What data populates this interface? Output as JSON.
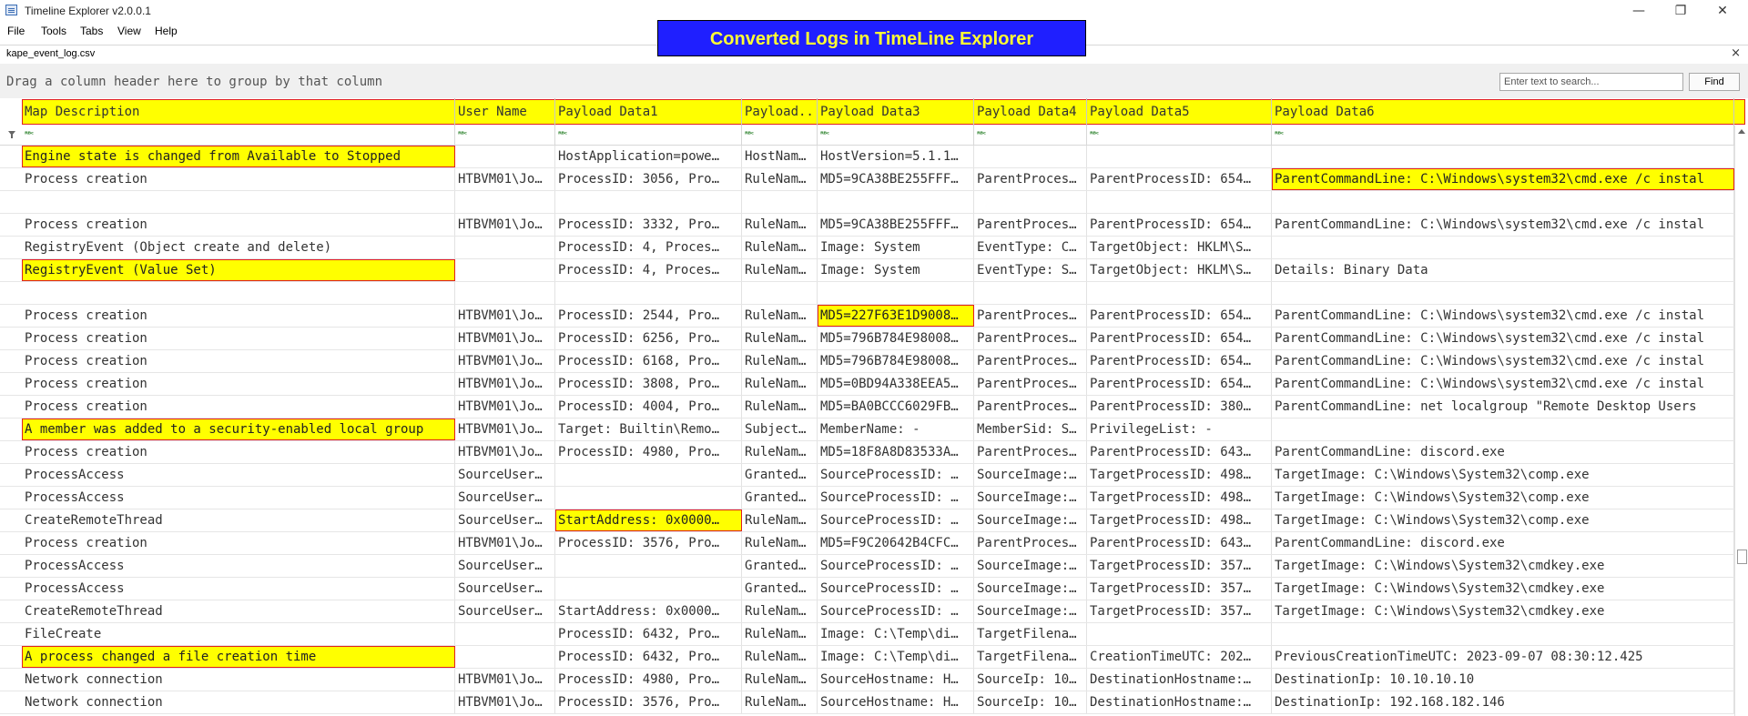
{
  "window": {
    "title": "Timeline Explorer v2.0.0.1",
    "minimize": "—",
    "maximize": "❐",
    "close": "✕"
  },
  "menu": [
    "File",
    "Tools",
    "Tabs",
    "View",
    "Help"
  ],
  "banner": "Converted Logs in TimeLine Explorer",
  "tab": {
    "label": "kape_event_log.csv",
    "close": "×"
  },
  "group_hint": "Drag a column header here to group by that column",
  "search": {
    "placeholder": "Enter text to search...",
    "find_label": "Find"
  },
  "columns": [
    "Map Description",
    "User Name",
    "Payload Data1",
    "Payload...",
    "Payload Data3",
    "Payload Data4",
    "Payload Data5",
    "Payload Data6"
  ],
  "filter_glyph": "ᴿᴮᶜ",
  "rows": [
    [
      "Engine state is changed from Available to Stopped",
      "",
      "HostApplication=powe…",
      "HostNam…",
      "HostVersion=5.1.1…",
      "",
      "",
      ""
    ],
    [
      "Process creation",
      "HTBVM01\\Jo…",
      "ProcessID: 3056, Pro…",
      "RuleNam…",
      "MD5=9CA38BE255FFF…",
      "ParentProces…",
      "ParentProcessID: 654…",
      "ParentCommandLine: C:\\Windows\\system32\\cmd.exe /c instal"
    ],
    [
      "",
      "",
      "",
      "",
      "",
      "",
      "",
      ""
    ],
    [
      "Process creation",
      "HTBVM01\\Jo…",
      "ProcessID: 3332, Pro…",
      "RuleNam…",
      "MD5=9CA38BE255FFF…",
      "ParentProces…",
      "ParentProcessID: 654…",
      "ParentCommandLine: C:\\Windows\\system32\\cmd.exe /c instal"
    ],
    [
      "RegistryEvent (Object create and delete)",
      "",
      "ProcessID: 4, Proces…",
      "RuleNam…",
      "Image: System",
      "EventType: C…",
      "TargetObject: HKLM\\S…",
      ""
    ],
    [
      "RegistryEvent (Value Set)",
      "",
      "ProcessID: 4, Proces…",
      "RuleNam…",
      "Image: System",
      "EventType: S…",
      "TargetObject: HKLM\\S…",
      "Details: Binary Data"
    ],
    [
      "",
      "",
      "",
      "",
      "",
      "",
      "",
      ""
    ],
    [
      "Process creation",
      "HTBVM01\\Jo…",
      "ProcessID: 2544, Pro…",
      "RuleNam…",
      "MD5=227F63E1D9008…",
      "ParentProces…",
      "ParentProcessID: 654…",
      "ParentCommandLine: C:\\Windows\\system32\\cmd.exe /c instal"
    ],
    [
      "Process creation",
      "HTBVM01\\Jo…",
      "ProcessID: 6256, Pro…",
      "RuleNam…",
      "MD5=796B784E98008…",
      "ParentProces…",
      "ParentProcessID: 654…",
      "ParentCommandLine: C:\\Windows\\system32\\cmd.exe /c instal"
    ],
    [
      "Process creation",
      "HTBVM01\\Jo…",
      "ProcessID: 6168, Pro…",
      "RuleNam…",
      "MD5=796B784E98008…",
      "ParentProces…",
      "ParentProcessID: 654…",
      "ParentCommandLine: C:\\Windows\\system32\\cmd.exe /c instal"
    ],
    [
      "Process creation",
      "HTBVM01\\Jo…",
      "ProcessID: 3808, Pro…",
      "RuleNam…",
      "MD5=0BD94A338EEA5…",
      "ParentProces…",
      "ParentProcessID: 654…",
      "ParentCommandLine: C:\\Windows\\system32\\cmd.exe /c instal"
    ],
    [
      "Process creation",
      "HTBVM01\\Jo…",
      "ProcessID: 4004, Pro…",
      "RuleNam…",
      "MD5=BA0BCCC6029FB…",
      "ParentProces…",
      "ParentProcessID: 380…",
      "ParentCommandLine: net  localgroup \"Remote Desktop Users"
    ],
    [
      "A member was added to a security-enabled local group",
      "HTBVM01\\Jo…",
      "Target: Builtin\\Remo…",
      "Subject…",
      "MemberName: -",
      "MemberSid: S…",
      "PrivilegeList: -",
      ""
    ],
    [
      "Process creation",
      "HTBVM01\\Jo…",
      "ProcessID: 4980, Pro…",
      "RuleNam…",
      "MD5=18F8A8D83533A…",
      "ParentProces…",
      "ParentProcessID: 643…",
      "ParentCommandLine: discord.exe"
    ],
    [
      "ProcessAccess",
      "SourceUser…",
      "",
      "Granted…",
      "SourceProcessID: …",
      "SourceImage:…",
      "TargetProcessID: 498…",
      "TargetImage: C:\\Windows\\System32\\comp.exe"
    ],
    [
      "ProcessAccess",
      "SourceUser…",
      "",
      "Granted…",
      "SourceProcessID: …",
      "SourceImage:…",
      "TargetProcessID: 498…",
      "TargetImage: C:\\Windows\\System32\\comp.exe"
    ],
    [
      "CreateRemoteThread",
      "SourceUser…",
      "StartAddress: 0x0000…",
      "RuleNam…",
      "SourceProcessID: …",
      "SourceImage:…",
      "TargetProcessID: 498…",
      "TargetImage: C:\\Windows\\System32\\comp.exe"
    ],
    [
      "Process creation",
      "HTBVM01\\Jo…",
      "ProcessID: 3576, Pro…",
      "RuleNam…",
      "MD5=F9C20642B4CFC…",
      "ParentProces…",
      "ParentProcessID: 643…",
      "ParentCommandLine: discord.exe"
    ],
    [
      "ProcessAccess",
      "SourceUser…",
      "",
      "Granted…",
      "SourceProcessID: …",
      "SourceImage:…",
      "TargetProcessID: 357…",
      "TargetImage: C:\\Windows\\System32\\cmdkey.exe"
    ],
    [
      "ProcessAccess",
      "SourceUser…",
      "",
      "Granted…",
      "SourceProcessID: …",
      "SourceImage:…",
      "TargetProcessID: 357…",
      "TargetImage: C:\\Windows\\System32\\cmdkey.exe"
    ],
    [
      "CreateRemoteThread",
      "SourceUser…",
      "StartAddress: 0x0000…",
      "RuleNam…",
      "SourceProcessID: …",
      "SourceImage:…",
      "TargetProcessID: 357…",
      "TargetImage: C:\\Windows\\System32\\cmdkey.exe"
    ],
    [
      "FileCreate",
      "",
      "ProcessID: 6432, Pro…",
      "RuleNam…",
      "Image: C:\\Temp\\di…",
      "TargetFilena…",
      "",
      ""
    ],
    [
      "A process changed a file creation time",
      "",
      "ProcessID: 6432, Pro…",
      "RuleNam…",
      "Image: C:\\Temp\\di…",
      "TargetFilena…",
      "CreationTimeUTC: 202…",
      "PreviousCreationTimeUTC: 2023-09-07 08:30:12.425"
    ],
    [
      "Network connection",
      "HTBVM01\\Jo…",
      "ProcessID: 4980, Pro…",
      "RuleNam…",
      "SourceHostname: H…",
      "SourceIp: 10…",
      "DestinationHostname:…",
      "DestinationIp: 10.10.10.10"
    ],
    [
      "Network connection",
      "HTBVM01\\Jo…",
      "ProcessID: 3576, Pro…",
      "RuleNam…",
      "SourceHostname: H…",
      "SourceIp: 10…",
      "DestinationHostname:…",
      "DestinationIp: 192.168.182.146"
    ]
  ],
  "highlights": [
    {
      "row": 0,
      "col": 0
    },
    {
      "row": 1,
      "col": 7
    },
    {
      "row": 5,
      "col": 0
    },
    {
      "row": 7,
      "col": 4
    },
    {
      "row": 12,
      "col": 0
    },
    {
      "row": 16,
      "col": 2
    },
    {
      "row": 22,
      "col": 0
    }
  ],
  "colors": {
    "highlight": "#ffff00",
    "highlight_border": "#e02020",
    "banner_bg": "#1f1fff",
    "banner_text": "#ffff33"
  }
}
